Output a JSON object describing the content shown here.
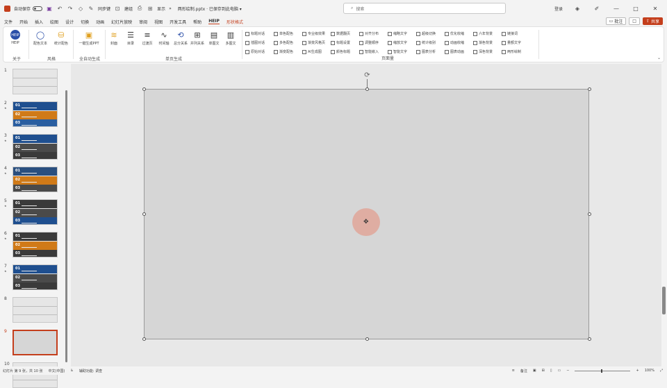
{
  "titlebar": {
    "autosave_label": "自动保存",
    "toolbar_icons": [
      "save-icon",
      "undo-icon",
      "redo-icon",
      "shape-icon",
      "format-painter-icon"
    ],
    "sync_label": "同步键",
    "group_label": "建组",
    "extra_label": "显示",
    "more_label": "»",
    "file_title": "两形绘制.pptx · 已保存到此电脑 ▾",
    "search_placeholder": "搜索",
    "user_label": "登录",
    "min": "—",
    "max": "□",
    "close": "✕"
  },
  "menubar": {
    "tabs": [
      "文件",
      "开始",
      "插入",
      "绘图",
      "设计",
      "切换",
      "动画",
      "幻灯片放映",
      "审阅",
      "视图",
      "开发工具",
      "帮助",
      "HEIP",
      "形状格式"
    ],
    "comment_label": "批注",
    "record_label": "□",
    "share_label": "共享"
  },
  "ribbon": {
    "groups": [
      {
        "label": "关于",
        "buttons": [
          {
            "icon": "heip-logo-icon",
            "label": "HEIP"
          }
        ]
      },
      {
        "label": "风格",
        "buttons": [
          {
            "icon": "shape-icon",
            "label": "配色文本"
          },
          {
            "icon": "bucket-icon",
            "label": "统计配色"
          }
        ]
      },
      {
        "label": "全自动生成",
        "buttons": [
          {
            "icon": "ppt-generate-icon",
            "label": "一键生成PPT"
          }
        ]
      },
      {
        "label": "单页生成",
        "buttons": [
          {
            "icon": "layers-icon",
            "label": "封面"
          },
          {
            "icon": "list-icon",
            "label": "目录"
          },
          {
            "icon": "outline-icon",
            "label": "过渡页"
          },
          {
            "icon": "timeline-icon",
            "label": "时间轴"
          },
          {
            "icon": "cycle-icon",
            "label": "总分关系"
          },
          {
            "icon": "grid-icon",
            "label": "并列关系"
          },
          {
            "icon": "compare-icon",
            "label": "单图文"
          },
          {
            "icon": "multi-icon",
            "label": "多图文"
          }
        ]
      }
    ],
    "checks_label": "页面量",
    "checks": [
      "标题对话",
      "单色配色",
      "专业级效果",
      "数据翻页",
      "对齐分布",
      "缩略文字",
      "超级切换",
      "优化收缩",
      "六年背景",
      "链接词",
      "插图对话",
      "多色配色",
      "渐变风格页",
      "标题设置",
      "调整顺序",
      "缩放文字",
      "统计级别",
      "动画收缩",
      "渐色背景",
      "量额文字",
      "原始对话",
      "渐变配色",
      "AI生成图",
      "颜色标题",
      "智能嵌入",
      "智能文字",
      "图表分析",
      "图表动画",
      "深色背景",
      "两形绘制"
    ]
  },
  "slides": [
    {
      "num": "1",
      "star": false,
      "kind": "blank"
    },
    {
      "num": "2",
      "star": true,
      "kind": "blue-orange",
      "labels": [
        "01",
        "02",
        "03"
      ]
    },
    {
      "num": "3",
      "star": true,
      "kind": "blue-dark",
      "labels": [
        "01",
        "02",
        "03"
      ]
    },
    {
      "num": "4",
      "star": true,
      "kind": "orange",
      "labels": [
        "01",
        "02",
        "03"
      ]
    },
    {
      "num": "5",
      "star": true,
      "kind": "dark-blue",
      "labels": [
        "01",
        "02",
        "03"
      ]
    },
    {
      "num": "6",
      "star": true,
      "kind": "dark-orange",
      "labels": [
        "01",
        "02",
        "03"
      ]
    },
    {
      "num": "7",
      "star": true,
      "kind": "blue-dark",
      "labels": [
        "01",
        "02",
        "03"
      ]
    },
    {
      "num": "8",
      "star": false,
      "kind": "blank"
    },
    {
      "num": "9",
      "star": false,
      "kind": "selected"
    },
    {
      "num": "10",
      "star": false,
      "kind": "blank"
    }
  ],
  "statusbar": {
    "slide_info": "幻灯片 第 9 张，共 10 张",
    "lang": "中文(中国)",
    "accessibility": "辅助功能: 调查",
    "notes_label": "备注",
    "zoom": "100%"
  }
}
